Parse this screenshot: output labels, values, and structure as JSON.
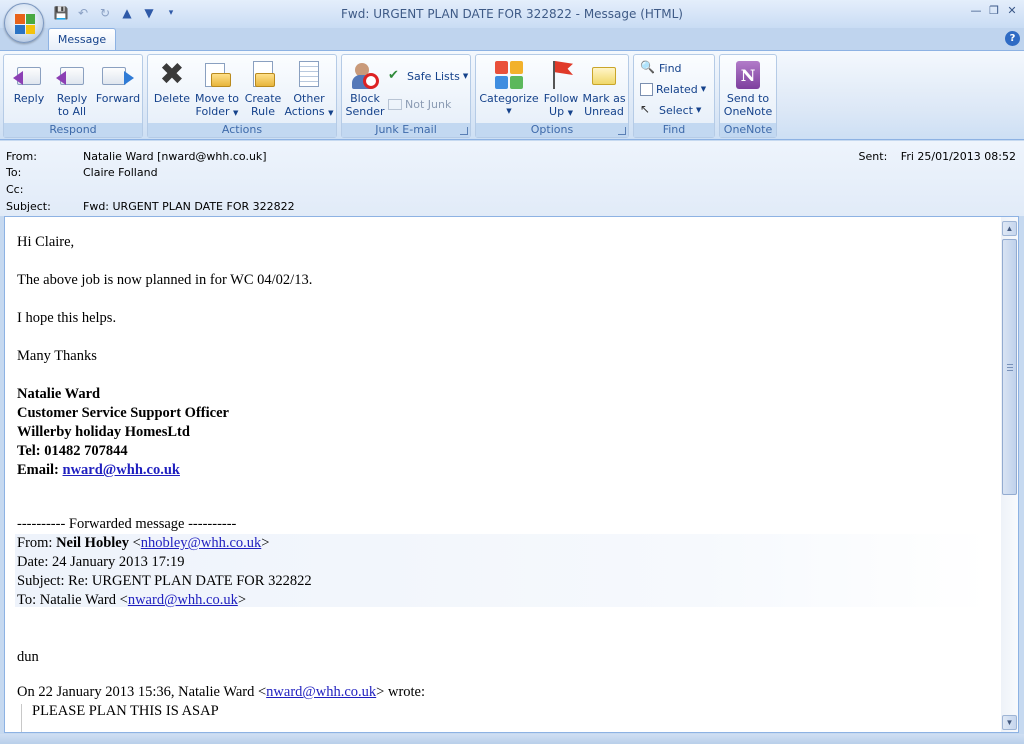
{
  "window": {
    "title": "Fwd: URGENT PLAN DATE FOR 322822 - Message (HTML)"
  },
  "ribbon": {
    "tab": "Message",
    "groups": {
      "respond": {
        "label": "Respond",
        "reply": "Reply",
        "reply_all_1": "Reply",
        "reply_all_2": "to All",
        "forward": "Forward"
      },
      "actions": {
        "label": "Actions",
        "delete": "Delete",
        "move_1": "Move to",
        "move_2": "Folder",
        "create_1": "Create",
        "create_2": "Rule",
        "other_1": "Other",
        "other_2": "Actions"
      },
      "junk": {
        "label": "Junk E-mail",
        "block_1": "Block",
        "block_2": "Sender",
        "safe_lists": "Safe Lists",
        "not_junk": "Not Junk"
      },
      "options": {
        "label": "Options",
        "categorize": "Categorize",
        "follow_1": "Follow",
        "follow_2": "Up",
        "mark_1": "Mark as",
        "mark_2": "Unread"
      },
      "find": {
        "label": "Find",
        "find": "Find",
        "related": "Related",
        "select": "Select"
      },
      "onenote": {
        "label": "OneNote",
        "send_1": "Send to",
        "send_2": "OneNote"
      }
    }
  },
  "headers": {
    "from_label": "From:",
    "from_value": "Natalie Ward [nward@whh.co.uk]",
    "to_label": "To:",
    "to_value": "Claire Folland",
    "cc_label": "Cc:",
    "cc_value": "",
    "subject_label": "Subject:",
    "subject_value": "Fwd: URGENT PLAN DATE FOR 322822",
    "sent_label": "Sent:",
    "sent_value": "Fri 25/01/2013 08:52"
  },
  "body": {
    "greeting": "Hi Claire,",
    "line1": "The above job is now planned in for WC 04/02/13.",
    "line2": "I hope this helps.",
    "thanks": "Many Thanks",
    "sig_name": "Natalie Ward",
    "sig_title": "Customer Service Support Officer",
    "sig_company": "Willerby holiday HomesLtd",
    "sig_tel": "Tel: 01482 707844",
    "sig_email_label": "Email: ",
    "sig_email": "nward@whh.co.uk",
    "fwd_header": "---------- Forwarded message ----------",
    "fwd_from_label": "From: ",
    "fwd_from_name": "Neil Hobley",
    "fwd_from_open": " <",
    "fwd_from_email": "nhobley@whh.co.uk",
    "fwd_close": ">",
    "fwd_date": "Date: 24 January 2013 17:19",
    "fwd_subject": "Subject: Re: URGENT PLAN DATE FOR 322822",
    "fwd_to_prefix": "To: Natalie Ward <",
    "fwd_to_email": "nward@whh.co.uk",
    "reply_text": "dun",
    "wrote_prefix": "On 22 January 2013 15:36, Natalie Ward <",
    "wrote_email": "nward@whh.co.uk",
    "wrote_suffix": "> wrote:",
    "quoted": "PLEASE PLAN THIS IS ASAP"
  }
}
